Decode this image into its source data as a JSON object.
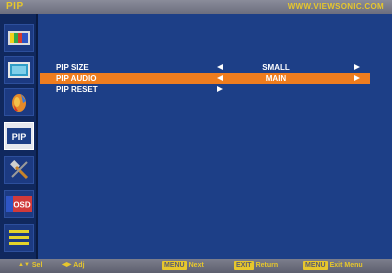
{
  "header": {
    "title": "PIP",
    "brand": "WWW.VIEWSONIC.COM"
  },
  "sidebar": {
    "items": [
      {
        "icon": "picture-icon"
      },
      {
        "icon": "screen-icon"
      },
      {
        "icon": "color-palette-icon"
      },
      {
        "icon": "pip-icon",
        "label": "PIP",
        "active": true
      },
      {
        "icon": "tools-icon"
      },
      {
        "icon": "osd-icon",
        "label": "OSD"
      },
      {
        "icon": "menu-list-icon"
      }
    ]
  },
  "menu": {
    "rows": [
      {
        "label": "PIP SIZE",
        "value": "SMALL",
        "selected": false
      },
      {
        "label": "PIP AUDIO",
        "value": "MAIN",
        "selected": true
      },
      {
        "label": "PIP RESET",
        "value": "",
        "selected": false
      }
    ]
  },
  "footer": {
    "hints": [
      {
        "keys": "▲▼",
        "label": "Sel"
      },
      {
        "keys": "◀▶",
        "label": "Adj"
      },
      {
        "keys": "MENU",
        "label": "Next"
      },
      {
        "keys": "EXIT",
        "label": "Return"
      },
      {
        "keys": "MENU",
        "label": "Exit Menu"
      }
    ]
  },
  "colors": {
    "background": "#1d3f87",
    "highlight": "#ef7d1e",
    "accent_text": "#e7c72c"
  }
}
